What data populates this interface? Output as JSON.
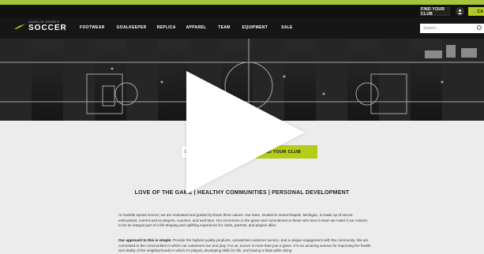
{
  "utility": {
    "find_club": "FIND YOUR CLUB",
    "cart": "CA"
  },
  "logo": {
    "small": "GAZELLE SPORTS",
    "big": "SOCCER"
  },
  "nav": {
    "items": [
      "FOOTWEAR",
      "GOALKEEPER",
      "REPLICA",
      "APPAREL",
      "TEAM",
      "EQUIPMENT",
      "SALE"
    ],
    "search_placeholder": "Search..."
  },
  "club_search": {
    "placeholder": "Search",
    "button": "FIND YOUR CLUB"
  },
  "tagline": "LOVE OF THE GAME | HEALTHY COMMUNITIES | PERSONAL DEVELOPMENT",
  "paragraphs": {
    "p1": "At Gazelle Sports Soccer, we are motivated and guided by those three values. Our team, located in Grand Rapids, Michigan, is made up of soccer enthusiasts: current and ex-players, coaches, and avid fans. Our immersion in the game and commitment to those who love it mean we make it our mission to be an integral part of a life-shaping and uplifting experience for clubs, parents, and players alike.",
    "p2_lead": "Our approach to this is simple:",
    "p2_rest": " Provide the highest quality products, unmatched customer service, and a unique engagement with the community. We are committed to the communities in which our customers live and play. For us, soccer is more than just a game. It is an amazing avenue for improving the health and vitality of the neighborhoods in which it's played, developing skills for life, and having a blast while doing"
  },
  "colors": {
    "accent": "#b5cc18",
    "frame": "#a8c43a",
    "nav_bg": "#161616"
  }
}
